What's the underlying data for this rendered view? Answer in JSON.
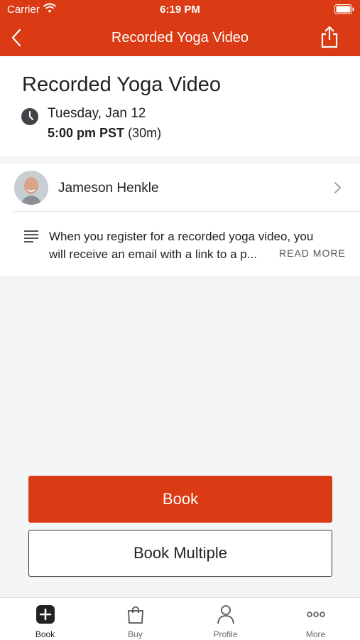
{
  "status_bar": {
    "carrier": "Carrier",
    "time": "6:19 PM"
  },
  "nav": {
    "title": "Recorded Yoga Video"
  },
  "header": {
    "title": "Recorded Yoga Video",
    "date": "Tuesday, Jan 12",
    "time": "5:00 pm PST",
    "duration": "(30m)"
  },
  "instructor": {
    "name": "Jameson Henkle"
  },
  "description": {
    "line1": "When you register for a recorded yoga video, you",
    "line2": "will receive an email with a link to a p...",
    "read_more": "READ MORE"
  },
  "actions": {
    "book": "Book",
    "book_multiple": "Book Multiple"
  },
  "tabs": [
    {
      "label": "Book",
      "icon": "plus-square-icon"
    },
    {
      "label": "Buy",
      "icon": "bag-icon"
    },
    {
      "label": "Profile",
      "icon": "person-icon"
    },
    {
      "label": "More",
      "icon": "ellipsis-icon"
    }
  ],
  "colors": {
    "accent": "#da3b14"
  }
}
